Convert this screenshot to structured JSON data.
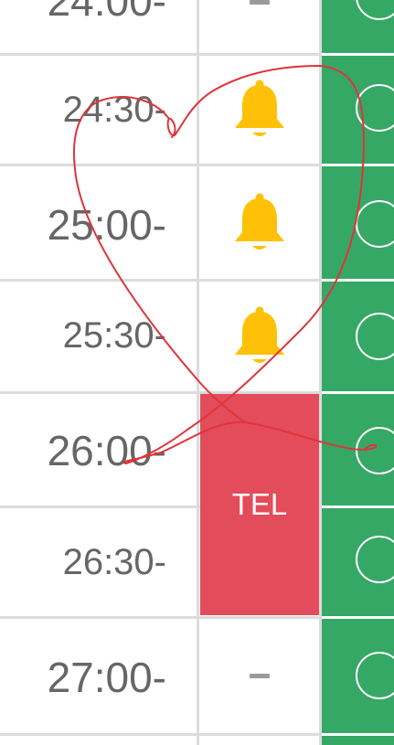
{
  "schedule": {
    "rows": [
      {
        "time": "24:00-",
        "status": "dash",
        "availability": "open"
      },
      {
        "time": "24:30-",
        "status": "bell",
        "availability": "open"
      },
      {
        "time": "25:00-",
        "status": "bell",
        "availability": "open"
      },
      {
        "time": "25:30-",
        "status": "bell",
        "availability": "open"
      },
      {
        "time": "26:00-",
        "status": "tel",
        "availability": "open"
      },
      {
        "time": "26:30-",
        "status": "tel",
        "availability": "open"
      },
      {
        "time": "27:00-",
        "status": "dash",
        "availability": "open"
      }
    ],
    "tel_label": "TEL"
  },
  "icons": {
    "bell": "bell-icon",
    "dash": "dash-icon",
    "available": "circle-icon",
    "annotation": "heart-doodle"
  },
  "colors": {
    "green": "#36a865",
    "tel_red": "#e34c5a",
    "bell_yellow": "#ffc107",
    "text_gray": "#666666",
    "grid_gray": "#dcdcdc",
    "doodle_red": "#e0333c"
  }
}
